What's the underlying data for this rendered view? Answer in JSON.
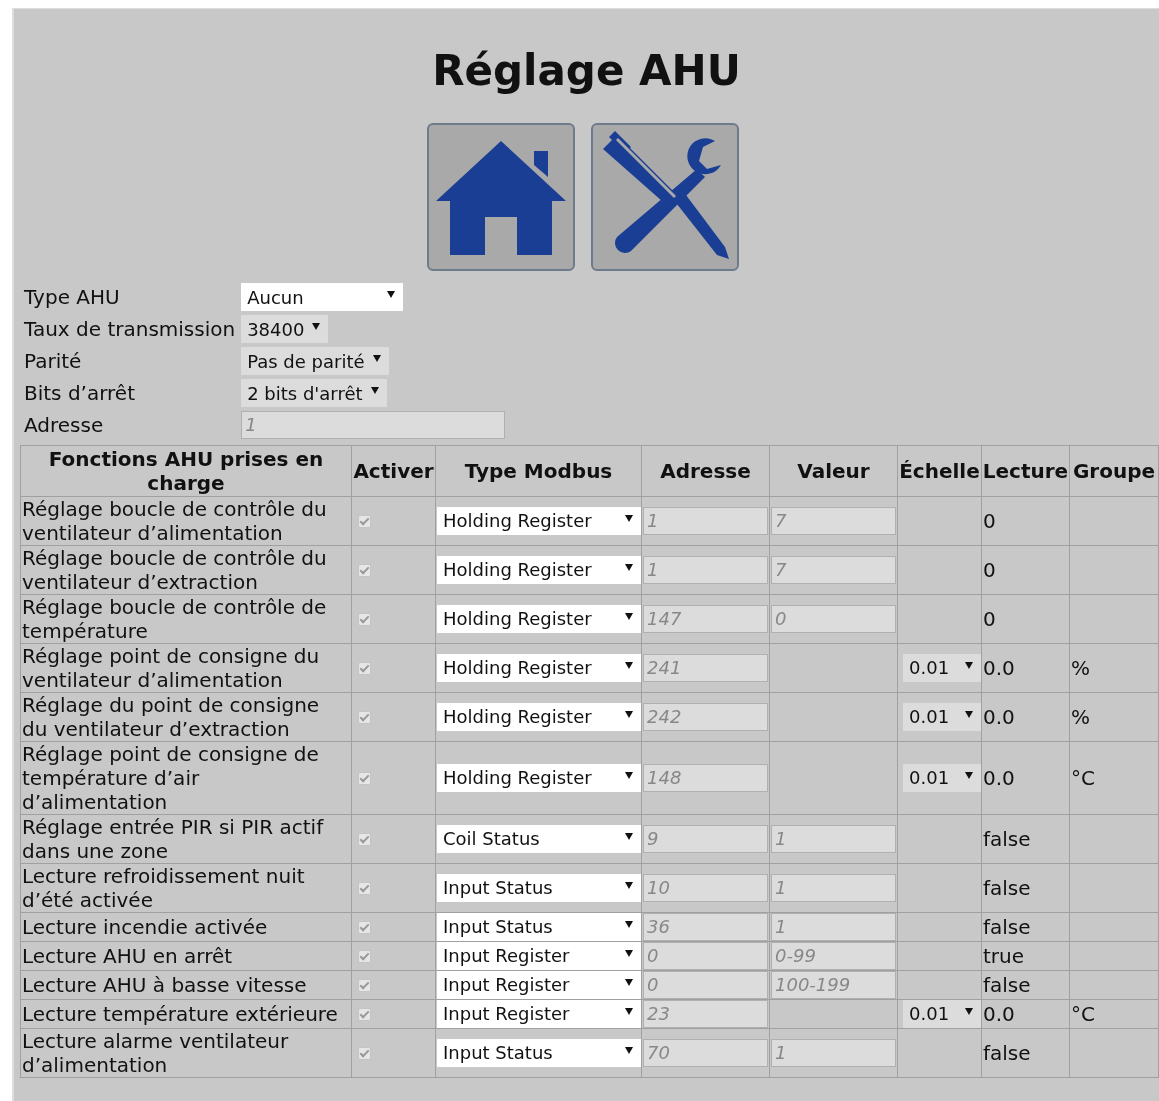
{
  "title": "Réglage AHU",
  "nav_buttons": [
    {
      "kind": "home"
    },
    {
      "kind": "tools"
    }
  ],
  "settings": [
    {
      "label": "Type AHU",
      "value": "Aucun",
      "kind": "select",
      "disabled": false
    },
    {
      "label": "Taux de transmission",
      "value": "38400",
      "kind": "select",
      "disabled": true
    },
    {
      "label": "Parité",
      "value": "Pas de parité",
      "kind": "select",
      "disabled": true
    },
    {
      "label": "Bits d’arrêt",
      "value": "2 bits d'arrêt",
      "kind": "select",
      "disabled": true
    },
    {
      "label": "Adresse",
      "value": "1",
      "kind": "input",
      "disabled": true
    }
  ],
  "table": {
    "columns": [
      "Fonctions AHU prises en charge",
      "Activer",
      "Type Modbus",
      "Adresse",
      "Valeur",
      "Échelle",
      "Lecture",
      "Groupe"
    ],
    "rows": [
      {
        "function": "Réglage boucle de contrôle du ventilateur d’alimentation",
        "checked": true,
        "disabled": true,
        "modbus_type": "Holding Register",
        "address": "1",
        "value": "7",
        "reading": "0"
      },
      {
        "function": "Réglage boucle de contrôle du ventilateur d’extraction",
        "checked": true,
        "disabled": true,
        "modbus_type": "Holding Register",
        "address": "1",
        "value": "7",
        "reading": "0"
      },
      {
        "function": "Réglage boucle de contrôle de température",
        "checked": true,
        "disabled": true,
        "modbus_type": "Holding Register",
        "address": "147",
        "value": "0",
        "reading": "0"
      },
      {
        "function": "Réglage point de consigne du ventilateur d’alimentation",
        "checked": true,
        "disabled": true,
        "modbus_type": "Holding Register",
        "address": "241",
        "scale": "0.01",
        "reading": "0.0",
        "group": "%"
      },
      {
        "function": "Réglage du point de consigne du ventilateur d’extraction",
        "checked": true,
        "disabled": true,
        "modbus_type": "Holding Register",
        "address": "242",
        "scale": "0.01",
        "reading": "0.0",
        "group": "%"
      },
      {
        "function": "Réglage point de consigne de température d’air d’alimentation",
        "checked": true,
        "disabled": true,
        "modbus_type": "Holding Register",
        "address": "148",
        "scale": "0.01",
        "reading": "0.0",
        "group": "°C"
      },
      {
        "function": "Réglage entrée PIR si PIR actif dans une zone",
        "checked": true,
        "disabled": true,
        "modbus_type": "Coil Status",
        "address": "9",
        "value": "1",
        "reading": "false"
      },
      {
        "function": "Lecture refroidissement nuit d’été activée",
        "checked": true,
        "disabled": true,
        "modbus_type": "Input Status",
        "address": "10",
        "value": "1",
        "reading": "false"
      },
      {
        "function": "Lecture incendie activée",
        "checked": true,
        "disabled": true,
        "modbus_type": "Input Status",
        "address": "36",
        "value": "1",
        "reading": "false"
      },
      {
        "function": "Lecture AHU en arrêt",
        "checked": true,
        "disabled": true,
        "modbus_type": "Input Register",
        "address": "0",
        "value": "0-99",
        "reading": "true"
      },
      {
        "function": "Lecture AHU à basse vitesse",
        "checked": true,
        "disabled": true,
        "modbus_type": "Input Register",
        "address": "0",
        "value": "100-199",
        "reading": "false"
      },
      {
        "function": "Lecture température extérieure",
        "checked": true,
        "disabled": true,
        "modbus_type": "Input Register",
        "address": "23",
        "scale": "0.01",
        "reading": "0.0",
        "group": "°C"
      },
      {
        "function": "Lecture alarme ventilateur d’alimentation",
        "checked": true,
        "disabled": true,
        "modbus_type": "Input Status",
        "address": "70",
        "value": "1",
        "reading": "false"
      }
    ]
  }
}
